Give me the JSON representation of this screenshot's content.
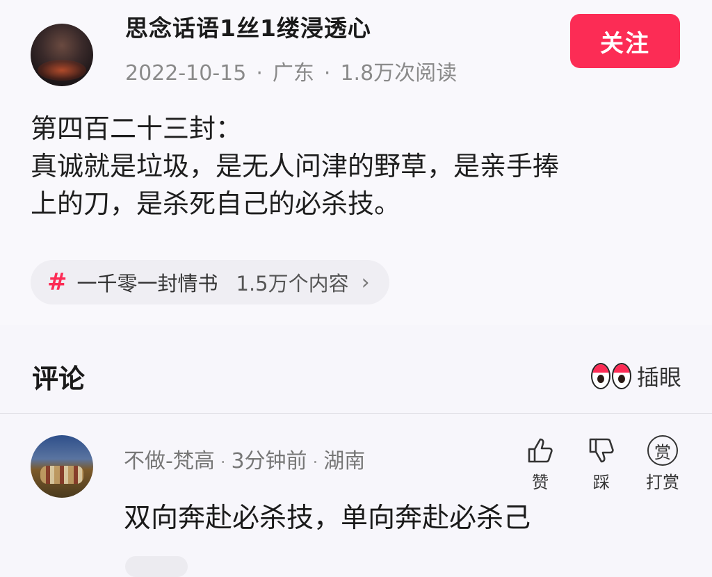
{
  "post": {
    "author": "思念话语1丝1缕浸透心",
    "date": "2022-10-15",
    "location": "广东",
    "reads": "1.8万次阅读",
    "meta_dot": "·",
    "follow_label": "关注",
    "text_lines": [
      "第四百二十三封：",
      "真诚就是垃圾，是无人问津的野草，是亲手捧",
      "上的刀，是杀死自己的必杀技。"
    ],
    "topic": {
      "icon": "hashtag-icon",
      "hash": "#",
      "name": "一千零一封情书",
      "count": "1.5万个内容",
      "chevron": "›"
    }
  },
  "comments_section": {
    "title": "评论",
    "insert_label": "插眼"
  },
  "comment": {
    "author": "不做-梵高",
    "time": "3分钟前",
    "location": "湖南",
    "sep": "·",
    "text": "双向奔赴必杀技，单向奔赴必杀己",
    "actions": {
      "like": "赞",
      "dislike": "踩",
      "reward": "打赏",
      "reward_glyph": "赏"
    }
  },
  "colors": {
    "accent": "#fc2c55",
    "meta_text": "#8a8a8a"
  }
}
